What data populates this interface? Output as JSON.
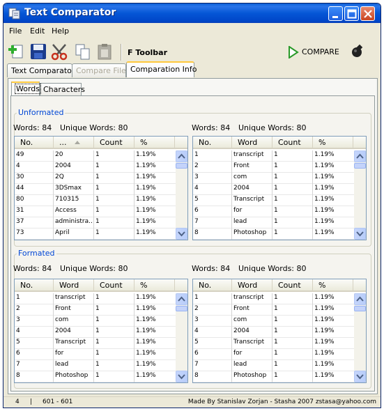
{
  "window": {
    "title": "Text Comparator"
  },
  "menu": [
    "File",
    "Edit",
    "Help"
  ],
  "toolbar": {
    "label": "F Toolbar",
    "compare_label": "COMPARE"
  },
  "tabs": [
    {
      "label": "Text Comparator",
      "state": "normal"
    },
    {
      "label": "Compare Files",
      "state": "disabled"
    },
    {
      "label": "Comparation Info",
      "state": "active"
    }
  ],
  "subtabs": [
    {
      "label": "Words",
      "state": "active"
    },
    {
      "label": "Characters",
      "state": "normal"
    }
  ],
  "sections": {
    "unformatted": {
      "title": "Unformated",
      "left": {
        "words_label": "Words: 84",
        "unique_label": "Unique Words: 80",
        "columns": [
          "No.",
          "...",
          "Count",
          "%"
        ],
        "rows": [
          [
            "49",
            "20",
            "1",
            "1.19%"
          ],
          [
            "4",
            "2004",
            "1",
            "1.19%"
          ],
          [
            "30",
            "2Q",
            "1",
            "1.19%"
          ],
          [
            "44",
            "3DSmax",
            "1",
            "1.19%"
          ],
          [
            "80",
            "710315",
            "1",
            "1.19%"
          ],
          [
            "31",
            "Access",
            "1",
            "1.19%"
          ],
          [
            "37",
            "administra...",
            "1",
            "1.19%"
          ],
          [
            "73",
            "April",
            "1",
            "1.19%"
          ]
        ]
      },
      "right": {
        "words_label": "Words: 84",
        "unique_label": "Unique Words: 80",
        "columns": [
          "No.",
          "Word",
          "Count",
          "%"
        ],
        "rows": [
          [
            "1",
            "transcript",
            "1",
            "1.19%"
          ],
          [
            "2",
            "Front",
            "1",
            "1.19%"
          ],
          [
            "3",
            "com",
            "1",
            "1.19%"
          ],
          [
            "4",
            "2004",
            "1",
            "1.19%"
          ],
          [
            "5",
            "Transcript",
            "1",
            "1.19%"
          ],
          [
            "6",
            "for",
            "1",
            "1.19%"
          ],
          [
            "7",
            "lead",
            "1",
            "1.19%"
          ],
          [
            "8",
            "Photoshop",
            "1",
            "1.19%"
          ]
        ]
      }
    },
    "formatted": {
      "title": "Formated",
      "left": {
        "words_label": "Words: 84",
        "unique_label": "Unique Words: 80",
        "columns": [
          "No.",
          "Word",
          "Count",
          "%"
        ],
        "rows": [
          [
            "1",
            "transcript",
            "1",
            "1.19%"
          ],
          [
            "2",
            "Front",
            "1",
            "1.19%"
          ],
          [
            "3",
            "com",
            "1",
            "1.19%"
          ],
          [
            "4",
            "2004",
            "1",
            "1.19%"
          ],
          [
            "5",
            "Transcript",
            "1",
            "1.19%"
          ],
          [
            "6",
            "for",
            "1",
            "1.19%"
          ],
          [
            "7",
            "lead",
            "1",
            "1.19%"
          ],
          [
            "8",
            "Photoshop",
            "1",
            "1.19%"
          ]
        ]
      },
      "right": {
        "words_label": "Words: 84",
        "unique_label": "Unique Words: 80",
        "columns": [
          "No.",
          "Word",
          "Count",
          "%"
        ],
        "rows": [
          [
            "1",
            "transcript",
            "1",
            "1.19%"
          ],
          [
            "2",
            "Front",
            "1",
            "1.19%"
          ],
          [
            "3",
            "com",
            "1",
            "1.19%"
          ],
          [
            "4",
            "2004",
            "1",
            "1.19%"
          ],
          [
            "5",
            "Transcript",
            "1",
            "1.19%"
          ],
          [
            "6",
            "for",
            "1",
            "1.19%"
          ],
          [
            "7",
            "lead",
            "1",
            "1.19%"
          ],
          [
            "8",
            "Photoshop",
            "1",
            "1.19%"
          ]
        ]
      }
    }
  },
  "status": {
    "position": "4",
    "separator": "|",
    "range": "601 - 601",
    "credit": "Made By Stanislav Zorjan - Stasha 2007 zstasa@yahoo.com"
  },
  "colors": {
    "accent": "#ffc83c",
    "group_title": "#0046d5",
    "titlebar": "#0556d6"
  },
  "icons": [
    "app-icon",
    "new-icon",
    "save-icon",
    "cut-icon",
    "copy-icon",
    "paste-icon",
    "compare-play-icon",
    "exit-icon"
  ]
}
